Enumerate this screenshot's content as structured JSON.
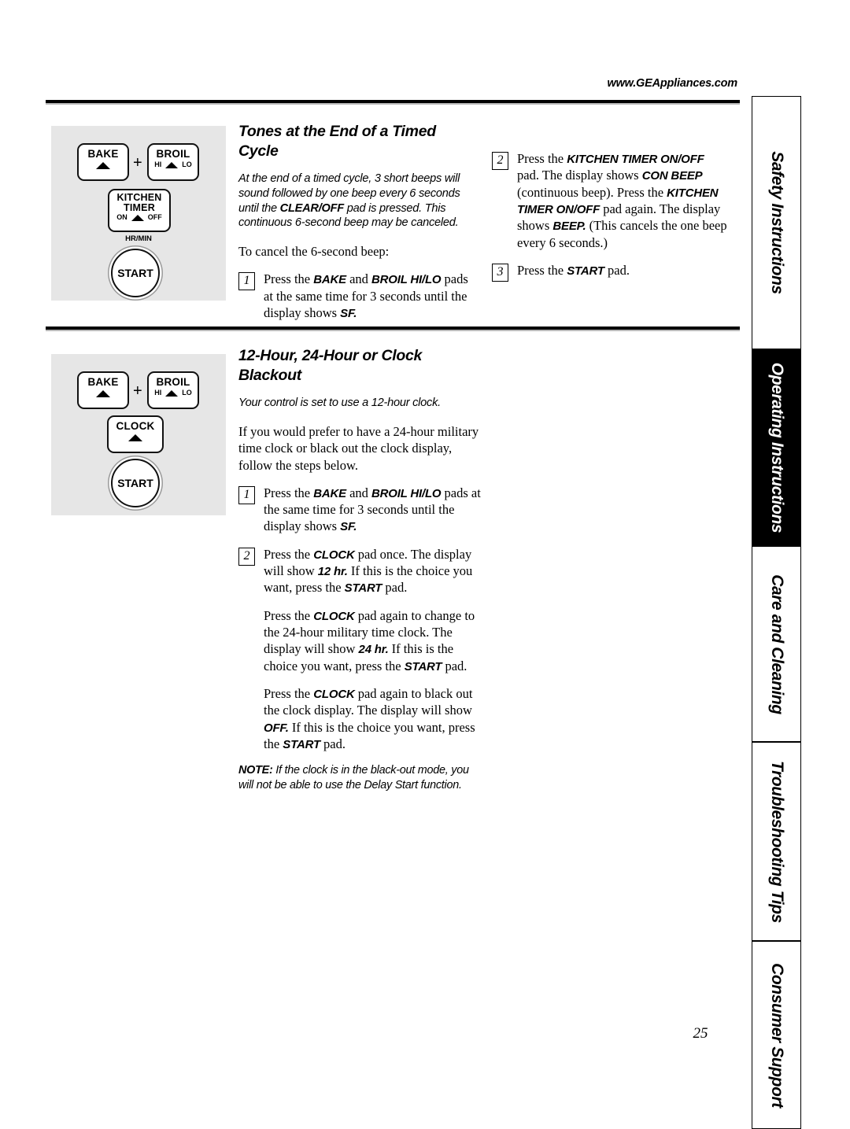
{
  "header": {
    "site_url": "www.GEAppliances.com"
  },
  "page_number": "25",
  "sections": [
    {
      "title": "Tones at the End of a Timed Cycle",
      "intro_italic": "At the end of a timed cycle, 3 short beeps will sound followed by one beep every 6 seconds until the CLEAR/OFF pad is pressed. This continuous 6-second beep may be canceled.",
      "intro_italic_bold_term": "CLEAR/OFF",
      "lead_in": "To cancel the 6-second beep:",
      "steps_left": [
        {
          "number": "1",
          "text": "Press the BAKE and BROIL HI/LO pads at the same time for 3 seconds until the display shows SF."
        }
      ],
      "steps_right": [
        {
          "number": "2",
          "text": "Press the KITCHEN TIMER ON/OFF pad. The display shows CON BEEP (continuous beep). Press the KITCHEN TIMER ON/OFF pad again. The display shows BEEP. (This cancels the one beep every 6 seconds.)"
        },
        {
          "number": "3",
          "text": "Press the START pad."
        }
      ],
      "diagram": {
        "pads": [
          "BAKE",
          "BROIL",
          "KITCHEN TIMER",
          "START"
        ],
        "bake_label": "BAKE",
        "plus_label": "+",
        "broil_label": "BROIL",
        "broil_hi": "HI",
        "broil_lo": "LO",
        "kitchen_line1": "KITCHEN",
        "kitchen_line2": "TIMER",
        "kitchen_on": "ON",
        "kitchen_off": "OFF",
        "hrmin_label": "HR/MIN",
        "start_label": "START"
      }
    },
    {
      "title": "12-Hour, 24-Hour or Clock Blackout",
      "intro_italic": "Your control is set to use a 12-hour clock.",
      "body_paragraph": "If you would prefer to have a 24-hour military time clock or black out the clock display, follow the steps below.",
      "steps": [
        {
          "number": "1",
          "text": "Press the BAKE and BROIL HI/LO pads at the same time for 3 seconds until the display shows SF."
        },
        {
          "number": "2",
          "text": "Press the CLOCK pad once. The display will show 12 hr. If this is the choice you want, press the START pad."
        }
      ],
      "extra_paragraphs": [
        "Press the CLOCK pad again to change to the 24-hour military time clock. The display will show 24 hr. If this is the choice you want, press the START pad.",
        "Press the CLOCK pad again to black out the clock display. The display will show OFF. If this is the choice you want, press the START pad."
      ],
      "note": {
        "label": "NOTE:",
        "text": "If the clock is in the black-out mode, you will not be able to use the Delay Start function."
      },
      "diagram": {
        "pads": [
          "BAKE",
          "BROIL",
          "CLOCK",
          "START"
        ],
        "bake_label": "BAKE",
        "plus_label": "+",
        "broil_label": "BROIL",
        "broil_hi": "HI",
        "broil_lo": "LO",
        "clock_label": "CLOCK",
        "start_label": "START"
      }
    }
  ],
  "side_tabs": [
    {
      "label": "Safety Instructions",
      "active": false
    },
    {
      "label": "Operating Instructions",
      "active": true
    },
    {
      "label": "Care and Cleaning",
      "active": false
    },
    {
      "label": "Troubleshooting Tips",
      "active": false
    },
    {
      "label": "Consumer Support",
      "active": false
    }
  ]
}
